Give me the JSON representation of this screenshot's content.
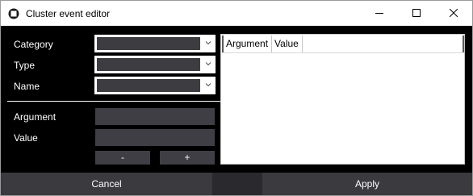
{
  "window": {
    "title": "Cluster event editor"
  },
  "form": {
    "category_label": "Category",
    "type_label": "Type",
    "name_label": "Name",
    "argument_label": "Argument",
    "value_label": "Value",
    "minus_label": "-",
    "plus_label": "+",
    "category_value": "",
    "type_value": "",
    "name_value": "",
    "argument_value": "",
    "value_value": ""
  },
  "grid": {
    "columns": [
      "Argument",
      "Value"
    ],
    "rows": []
  },
  "footer": {
    "cancel_label": "Cancel",
    "apply_label": "Apply"
  },
  "colors": {
    "window_bg": "#000000",
    "control_bg": "#3e3e44",
    "combo_frame": "#ffffff"
  }
}
